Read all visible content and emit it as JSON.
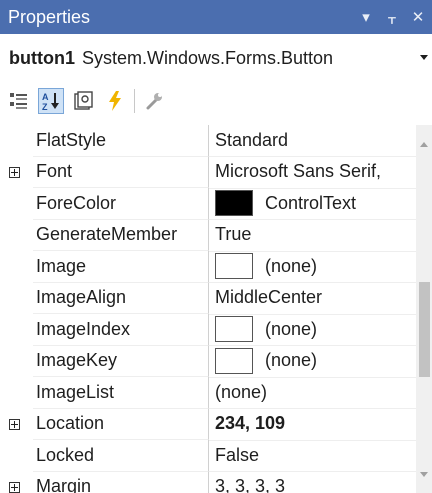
{
  "window": {
    "title": "Properties",
    "btn_dropdown": "▾",
    "btn_pin": "ᚁ",
    "btn_close": "✕"
  },
  "object_selector": {
    "name": "button1",
    "type": "System.Windows.Forms.Button"
  },
  "toolbar": {
    "buttons": [
      "categorized-icon",
      "alphabetical-icon",
      "property-pages-icon",
      "events-icon",
      "wrench-icon"
    ],
    "active": "alphabetical-icon"
  },
  "properties": [
    {
      "name": "FlatStyle",
      "value": "Standard"
    },
    {
      "name": "Font",
      "value": "Microsoft Sans Serif,",
      "expandable": true
    },
    {
      "name": "ForeColor",
      "value": "ControlText",
      "swatch": "#000000"
    },
    {
      "name": "GenerateMember",
      "value": "True"
    },
    {
      "name": "Image",
      "value": "(none)",
      "swatch": "#ffffff"
    },
    {
      "name": "ImageAlign",
      "value": "MiddleCenter"
    },
    {
      "name": "ImageIndex",
      "value": "(none)",
      "swatch": "#ffffff"
    },
    {
      "name": "ImageKey",
      "value": "(none)",
      "swatch": "#ffffff"
    },
    {
      "name": "ImageList",
      "value": "(none)"
    },
    {
      "name": "Location",
      "value": "234, 109",
      "expandable": true,
      "bold": true
    },
    {
      "name": "Locked",
      "value": "False"
    },
    {
      "name": "Margin",
      "value": "3, 3, 3, 3",
      "expandable": true
    }
  ],
  "colors": {
    "titlebar": "#4b6eaf",
    "toolbar_active": "#cfe2f6",
    "events_icon": "#f0b400"
  }
}
